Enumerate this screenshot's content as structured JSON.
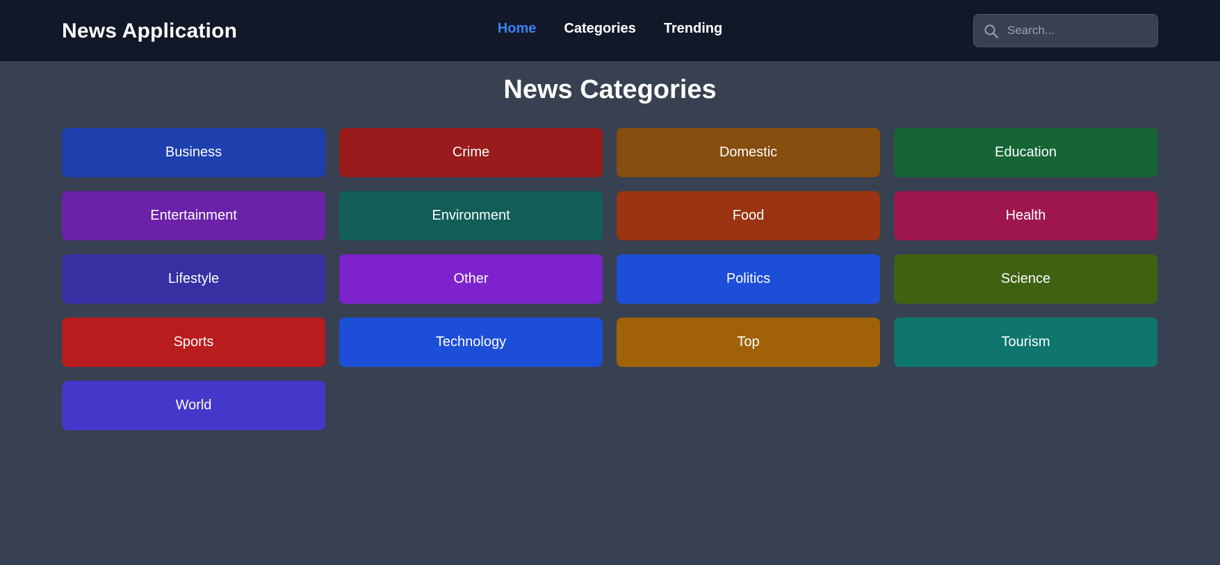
{
  "header": {
    "brand": "News Application",
    "nav": [
      {
        "label": "Home",
        "active": true
      },
      {
        "label": "Categories",
        "active": false
      },
      {
        "label": "Trending",
        "active": false
      }
    ],
    "search": {
      "placeholder": "Search...",
      "value": "",
      "icon": "search-icon"
    }
  },
  "main": {
    "title": "News Categories",
    "categories": [
      {
        "label": "Business",
        "color": "#1e40af"
      },
      {
        "label": "Crime",
        "color": "#991b1b"
      },
      {
        "label": "Domestic",
        "color": "#854d0e"
      },
      {
        "label": "Education",
        "color": "#166534"
      },
      {
        "label": "Entertainment",
        "color": "#6b21a8"
      },
      {
        "label": "Environment",
        "color": "#115e59"
      },
      {
        "label": "Food",
        "color": "#9a3412"
      },
      {
        "label": "Health",
        "color": "#9d174d"
      },
      {
        "label": "Lifestyle",
        "color": "#3730a3"
      },
      {
        "label": "Other",
        "color": "#7e22ce"
      },
      {
        "label": "Politics",
        "color": "#1d4ed8"
      },
      {
        "label": "Science",
        "color": "#3f6212"
      },
      {
        "label": "Sports",
        "color": "#b91c1c"
      },
      {
        "label": "Technology",
        "color": "#1d4ed8"
      },
      {
        "label": "Top",
        "color": "#a16207"
      },
      {
        "label": "Tourism",
        "color": "#0f766e"
      },
      {
        "label": "World",
        "color": "#4338ca"
      }
    ]
  },
  "colors": {
    "background": "#374151",
    "navbar": "#111827",
    "accent": "#3b82f6"
  }
}
